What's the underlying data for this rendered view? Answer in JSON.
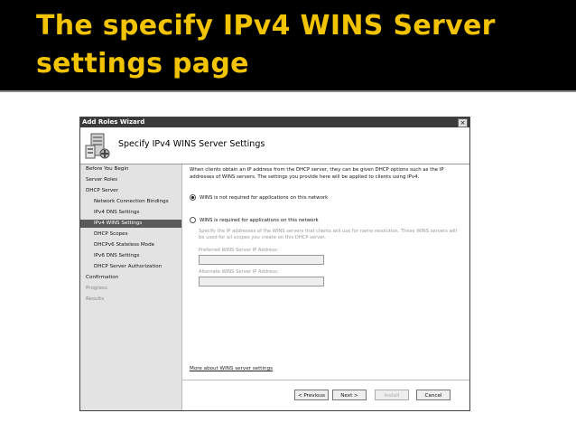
{
  "slide": {
    "title_line1": "The specify IPv4 WINS Server",
    "title_line2": "settings page"
  },
  "wizard": {
    "window_title": "Add Roles Wizard",
    "close_glyph": "×",
    "banner_icon": "server-role-icon",
    "page_title": "Specify IPv4 WINS Server Settings",
    "steps": [
      {
        "label": "Before You Begin"
      },
      {
        "label": "Server Roles"
      },
      {
        "label": "DHCP Server"
      },
      {
        "label": "Network Connection Bindings"
      },
      {
        "label": "IPv4 DNS Settings"
      },
      {
        "label": "IPv4 WINS Settings"
      },
      {
        "label": "DHCP Scopes"
      },
      {
        "label": "DHCPv6 Stateless Mode"
      },
      {
        "label": "IPv6 DNS Settings"
      },
      {
        "label": "DHCP Server Authorization"
      },
      {
        "label": "Confirmation"
      },
      {
        "label": "Progress"
      },
      {
        "label": "Results"
      }
    ],
    "intro_text": "When clients obtain an IP address from the DHCP server, they can be given DHCP options such as the IP addresses of WINS servers. The settings you provide here will be applied to clients using IPv4.",
    "option_not_required": "WINS is not required for applications on this network",
    "option_required": "WINS is required for applications on this network",
    "selected_option": "not_required",
    "hint_text": "Specify the IP addresses of the WINS servers that clients will use for name resolution. These WINS servers will be used for all scopes you create on this DHCP server.",
    "preferred_label": "Preferred WINS Server IP Address:",
    "preferred_value": "",
    "alternate_label": "Alternate WINS Server IP Address:",
    "alternate_value": "",
    "more_link": "More about WINS server settings",
    "buttons": {
      "previous": "< Previous",
      "next": "Next >",
      "install": "Install",
      "cancel": "Cancel"
    }
  }
}
